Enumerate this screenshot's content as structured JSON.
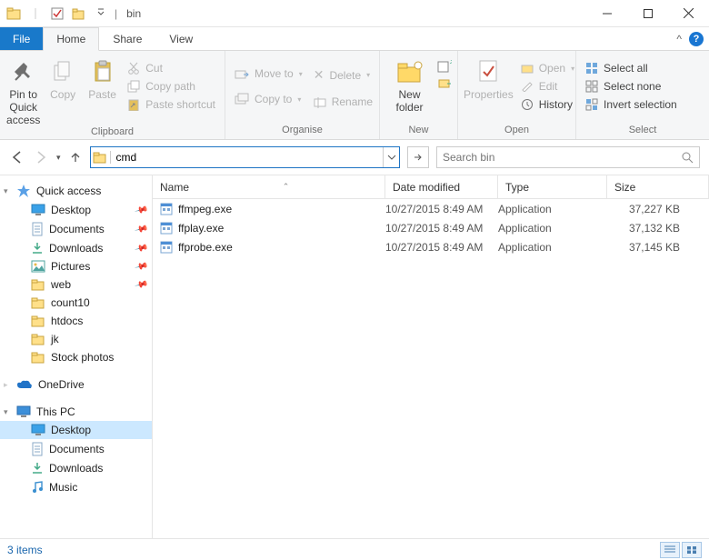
{
  "window": {
    "title": "bin"
  },
  "menubar": {
    "file": "File",
    "tabs": [
      "Home",
      "Share",
      "View"
    ],
    "active": 0
  },
  "ribbon": {
    "clipboard": {
      "label": "Clipboard",
      "pin": "Pin to Quick access",
      "copy": "Copy",
      "paste": "Paste",
      "cut": "Cut",
      "copy_path": "Copy path",
      "paste_shortcut": "Paste shortcut"
    },
    "organise": {
      "label": "Organise",
      "move_to": "Move to",
      "copy_to": "Copy to",
      "delete": "Delete",
      "rename": "Rename"
    },
    "new": {
      "label": "New",
      "new_folder": "New folder"
    },
    "open": {
      "label": "Open",
      "properties": "Properties",
      "open": "Open",
      "edit": "Edit",
      "history": "History"
    },
    "select": {
      "label": "Select",
      "select_all": "Select all",
      "select_none": "Select none",
      "invert": "Invert selection"
    }
  },
  "address": {
    "value": "cmd",
    "search_placeholder": "Search bin"
  },
  "columns": {
    "name": "Name",
    "date": "Date modified",
    "type": "Type",
    "size": "Size"
  },
  "files": [
    {
      "name": "ffmpeg.exe",
      "date": "10/27/2015 8:49 AM",
      "type": "Application",
      "size": "37,227 KB"
    },
    {
      "name": "ffplay.exe",
      "date": "10/27/2015 8:49 AM",
      "type": "Application",
      "size": "37,132 KB"
    },
    {
      "name": "ffprobe.exe",
      "date": "10/27/2015 8:49 AM",
      "type": "Application",
      "size": "37,145 KB"
    }
  ],
  "sidebar": {
    "quick_access": "Quick access",
    "quick_items": [
      {
        "label": "Desktop",
        "icon": "desktop",
        "pinned": true
      },
      {
        "label": "Documents",
        "icon": "doc",
        "pinned": true
      },
      {
        "label": "Downloads",
        "icon": "download",
        "pinned": true
      },
      {
        "label": "Pictures",
        "icon": "pictures",
        "pinned": true
      },
      {
        "label": "web",
        "icon": "folder",
        "pinned": true
      },
      {
        "label": "count10",
        "icon": "folder",
        "pinned": false
      },
      {
        "label": "htdocs",
        "icon": "folder",
        "pinned": false
      },
      {
        "label": "jk",
        "icon": "folder",
        "pinned": false
      },
      {
        "label": "Stock photos",
        "icon": "folder",
        "pinned": false
      }
    ],
    "onedrive": "OneDrive",
    "this_pc": "This PC",
    "pc_items": [
      {
        "label": "Desktop",
        "icon": "desktop",
        "selected": true
      },
      {
        "label": "Documents",
        "icon": "doc"
      },
      {
        "label": "Downloads",
        "icon": "download"
      },
      {
        "label": "Music",
        "icon": "music"
      }
    ]
  },
  "status": {
    "count": "3 items"
  }
}
